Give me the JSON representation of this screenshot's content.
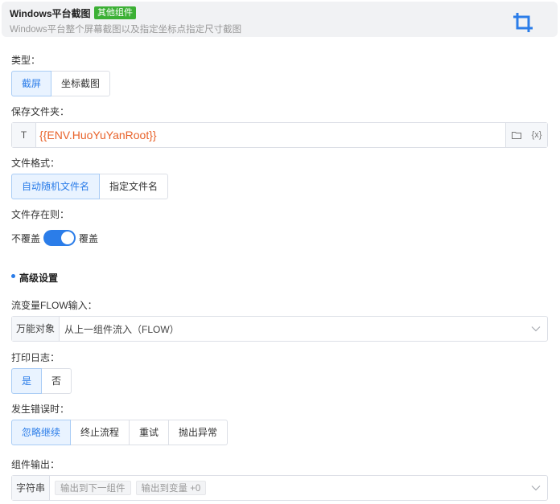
{
  "header": {
    "title": "Windows平台截图",
    "tag": "其他组件",
    "description": "Windows平台整个屏幕截图以及指定坐标点指定尺寸截图",
    "icon": "crop-icon"
  },
  "type_field": {
    "label": "类型：",
    "options": [
      "截屏",
      "坐标截图"
    ],
    "selected": "截屏"
  },
  "folder_field": {
    "label": "保存文件夹：",
    "prefix": "T",
    "value": "{{ENV.HuoYuYanRoot}}",
    "var_button": "{x}"
  },
  "format_field": {
    "label": "文件格式：",
    "options": [
      "自动随机文件名",
      "指定文件名"
    ],
    "selected": "自动随机文件名"
  },
  "exists_field": {
    "label": "文件存在则：",
    "off_label": "不覆盖",
    "on_label": "覆盖",
    "value": true
  },
  "advanced": {
    "title": "高级设置"
  },
  "flow_field": {
    "label": "流变量FLOW输入：",
    "prefix": "万能对象",
    "value": "从上一组件流入（FLOW）"
  },
  "log_field": {
    "label": "打印日志：",
    "options": [
      "是",
      "否"
    ],
    "selected": "是"
  },
  "error_field": {
    "label": "发生错误时：",
    "options": [
      "忽略继续",
      "终止流程",
      "重试",
      "抛出异常"
    ],
    "selected": "忽略继续"
  },
  "output_field": {
    "label": "组件输出：",
    "prefix": "字符串",
    "chips": [
      "输出到下一组件",
      "输出到变量 +0"
    ]
  },
  "colors": {
    "accent": "#2b7de9",
    "tag": "#3cb035",
    "path": "#e8632b"
  }
}
